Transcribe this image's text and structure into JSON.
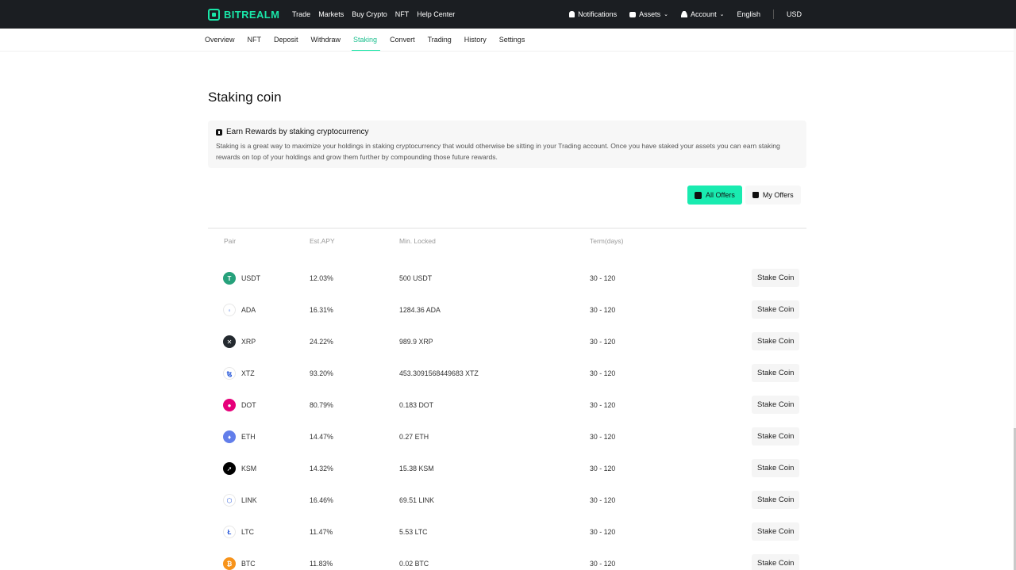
{
  "header": {
    "brand": "BITREALM",
    "nav": [
      "Trade",
      "Markets",
      "Buy Crypto",
      "NFT",
      "Help Center"
    ],
    "right": {
      "notifications": "Notifications",
      "assets": "Assets",
      "account": "Account",
      "language": "English",
      "currency": "USD"
    }
  },
  "subnav": {
    "items": [
      "Overview",
      "NFT",
      "Deposit",
      "Withdraw",
      "Staking",
      "Convert",
      "Trading",
      "History",
      "Settings"
    ],
    "active": "Staking"
  },
  "page": {
    "title": "Staking coin",
    "info_title": "Earn Rewards by staking cryptocurrency",
    "info_text": "Staking is a great way to maximize your holdings in staking cryptocurrency that would otherwise be sitting in your Trading account. Once you have staked your assets you can earn staking rewards on top of your holdings and grow them further by compounding those future rewards."
  },
  "offers": {
    "all_label": "All Offers",
    "my_label": "My Offers",
    "active": "all"
  },
  "table": {
    "headers": [
      "Pair",
      "Est.APY",
      "Min. Locked",
      "Term(days)"
    ],
    "action_label": "Stake Coin",
    "rows": [
      {
        "coin": "USDT",
        "apy": "12.03%",
        "min": "500 USDT",
        "term": "30 - 120",
        "color": "#26a17b",
        "glyph": "T"
      },
      {
        "coin": "ADA",
        "apy": "16.31%",
        "min": "1284.36 ADA",
        "term": "30 - 120",
        "color": "#ffffff",
        "glyph": "◦"
      },
      {
        "coin": "XRP",
        "apy": "24.22%",
        "min": "989.9 XRP",
        "term": "30 - 120",
        "color": "#23292f",
        "glyph": "✕"
      },
      {
        "coin": "XTZ",
        "apy": "93.20%",
        "min": "453.3091568449683 XTZ",
        "term": "30 - 120",
        "color": "#ffffff",
        "glyph": "ꜩ"
      },
      {
        "coin": "DOT",
        "apy": "80.79%",
        "min": "0.183 DOT",
        "term": "30 - 120",
        "color": "#e6007a",
        "glyph": "●"
      },
      {
        "coin": "ETH",
        "apy": "14.47%",
        "min": "0.27 ETH",
        "term": "30 - 120",
        "color": "#627eea",
        "glyph": "♦"
      },
      {
        "coin": "KSM",
        "apy": "14.32%",
        "min": "15.38 KSM",
        "term": "30 - 120",
        "color": "#000000",
        "glyph": "➚"
      },
      {
        "coin": "LINK",
        "apy": "16.46%",
        "min": "69.51 LINK",
        "term": "30 - 120",
        "color": "#ffffff",
        "glyph": "⬡"
      },
      {
        "coin": "LTC",
        "apy": "11.47%",
        "min": "5.53 LTC",
        "term": "30 - 120",
        "color": "#ffffff",
        "glyph": "Ł"
      },
      {
        "coin": "BTC",
        "apy": "11.83%",
        "min": "0.02 BTC",
        "term": "30 - 120",
        "color": "#f7931a",
        "glyph": "₿"
      }
    ]
  }
}
